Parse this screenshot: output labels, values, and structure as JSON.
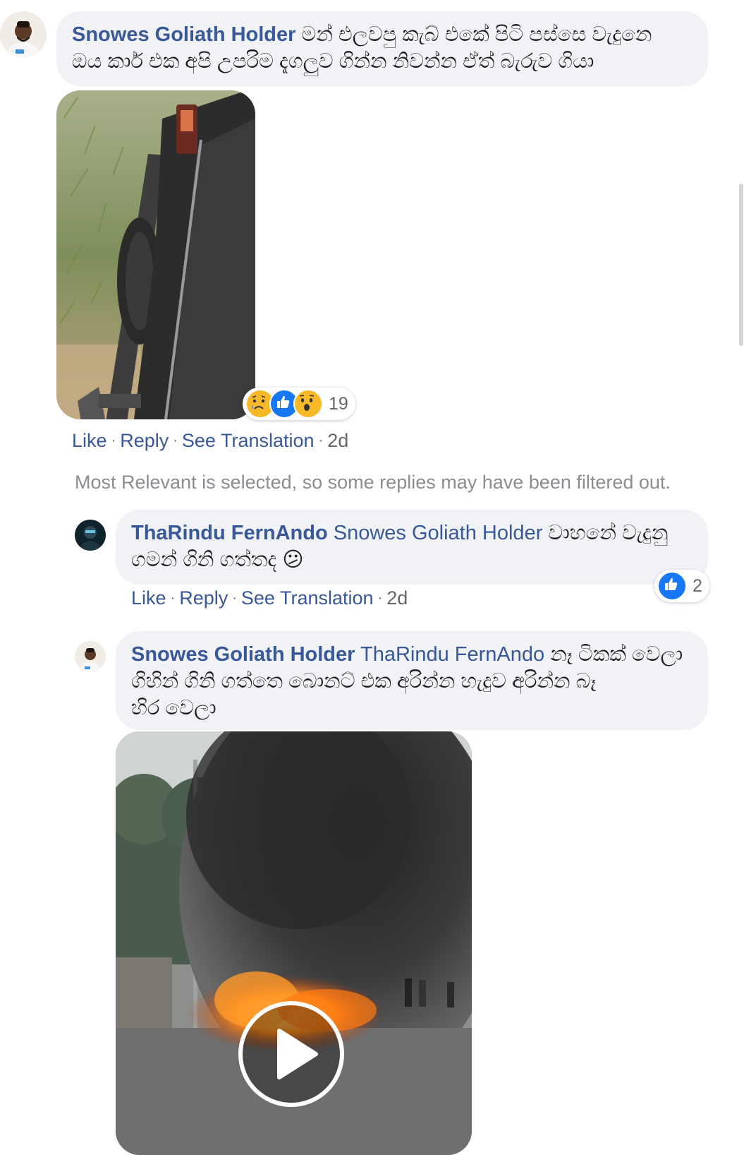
{
  "comments": [
    {
      "author": "Snowes Goliath Holder",
      "text": "මන් එලවපු කැබ් එකේ පිටි පස්සෙ වැදුනෙ ඔය කාර් එක අපි උපරිම දැගලුව ගින්න නිවන්න ඒත් බැරුව ගියා",
      "text_line1": "මන් එලවපු කැබ් එකේ පිටි පස්සෙ වැදුනෙ",
      "text_line2": "ඔය කාර් එක අපි උපරිම දැගලුව ගින්න නිවන්න ඒත් බැරුව ගියා",
      "reactions": {
        "icons": [
          "sad-reaction",
          "like-reaction",
          "wow-reaction"
        ],
        "count": "19"
      },
      "actions": {
        "like": "Like",
        "reply": "Reply",
        "translate": "See Translation",
        "time": "2d"
      }
    }
  ],
  "filter_note": "Most Relevant is selected, so some replies may have been filtered out.",
  "replies": [
    {
      "author": "ThaRindu FernAndo",
      "mention": "Snowes Goliath Holder",
      "text_line1": "වාහනේ වැදුනු",
      "text_line2": "ගමන් ගිනි ගත්තද",
      "emoji": "😕",
      "reactions": {
        "icons": [
          "like-reaction"
        ],
        "count": "2"
      },
      "actions": {
        "like": "Like",
        "reply": "Reply",
        "translate": "See Translation",
        "time": "2d"
      }
    },
    {
      "author": "Snowes Goliath Holder",
      "mention": "ThaRindu FernAndo",
      "text_line1": "නෑ ටිකක් වෙලා",
      "text_line2": "ගිහින් ගිනි ගත්තෙ බොනට් එක අරින්න හැදුව අරින්න බෑ",
      "text_line3": "හිර වෙලා"
    }
  ],
  "colors": {
    "link_blue": "#385898",
    "bubble_bg": "#f0f2f5",
    "meta_gray": "#65676b",
    "like_blue": "#1877f2"
  }
}
